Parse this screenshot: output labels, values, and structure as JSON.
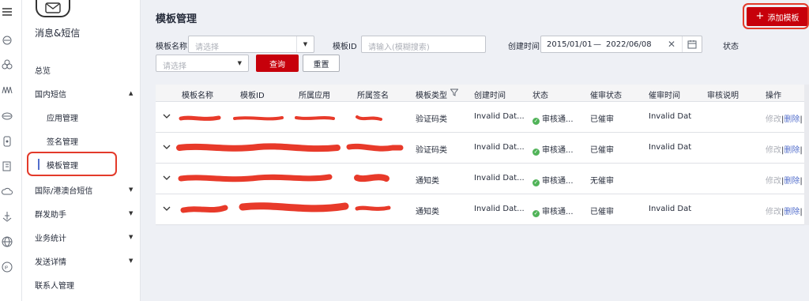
{
  "sidebar": {
    "service_title": "消息&短信",
    "items": [
      {
        "label": "总览"
      },
      {
        "label": "国内短信",
        "expanded": true
      },
      {
        "label": "应用管理"
      },
      {
        "label": "签名管理"
      },
      {
        "label": "模板管理",
        "active": true
      },
      {
        "label": "国际/港澳台短信"
      },
      {
        "label": "群发助手"
      },
      {
        "label": "业务统计"
      },
      {
        "label": "发送详情"
      },
      {
        "label": "联系人管理"
      }
    ]
  },
  "page": {
    "title": "模板管理",
    "add_button": "添加模板"
  },
  "filters": {
    "name_label": "模板名称",
    "name_placeholder": "请选择",
    "id_label": "模板ID",
    "id_placeholder": "请输入(模糊搜索)",
    "time_label": "创建时间",
    "start_date": "2015/01/01",
    "range_sep": "—",
    "end_date": "2022/06/08",
    "status_label": "状态",
    "status_placeholder": "请选择",
    "query_button": "查询",
    "reset_button": "重置"
  },
  "table": {
    "columns": [
      "模板名称",
      "模板ID",
      "所属应用",
      "所属签名",
      "模板类型",
      "创建时间",
      "状态",
      "催审状态",
      "催审时间",
      "审核说明",
      "操作"
    ],
    "rows": [
      {
        "type": "验证码类",
        "created": "Invalid Dat...",
        "status": "审核通...",
        "urge_status": "已催审",
        "urge_time": "Invalid Dat",
        "op_edit": "修改",
        "op_sep": "|",
        "op_delete": "删除",
        "op_more": "|"
      },
      {
        "type": "验证码类",
        "created": "Invalid Dat...",
        "status": "审核通...",
        "urge_status": "已催审",
        "urge_time": "Invalid Dat",
        "op_edit": "修改",
        "op_sep": "|",
        "op_delete": "删除",
        "op_more": "|"
      },
      {
        "type": "通知类",
        "created": "Invalid Dat...",
        "status": "审核通...",
        "urge_status": "无催审",
        "urge_time": "",
        "op_edit": "修改",
        "op_sep": "|",
        "op_delete": "删除",
        "op_more": "|"
      },
      {
        "type": "通知类",
        "created": "Invalid Dat...",
        "status": "审核通...",
        "urge_status": "已催审",
        "urge_time": "Invalid Dat",
        "op_edit": "修改",
        "op_sep": "|",
        "op_delete": "删除",
        "op_more": "|"
      }
    ]
  },
  "colors": {
    "primary": "#c7000b",
    "link": "#526ecc",
    "success": "#50b358",
    "annotation": "#e33a2a"
  }
}
